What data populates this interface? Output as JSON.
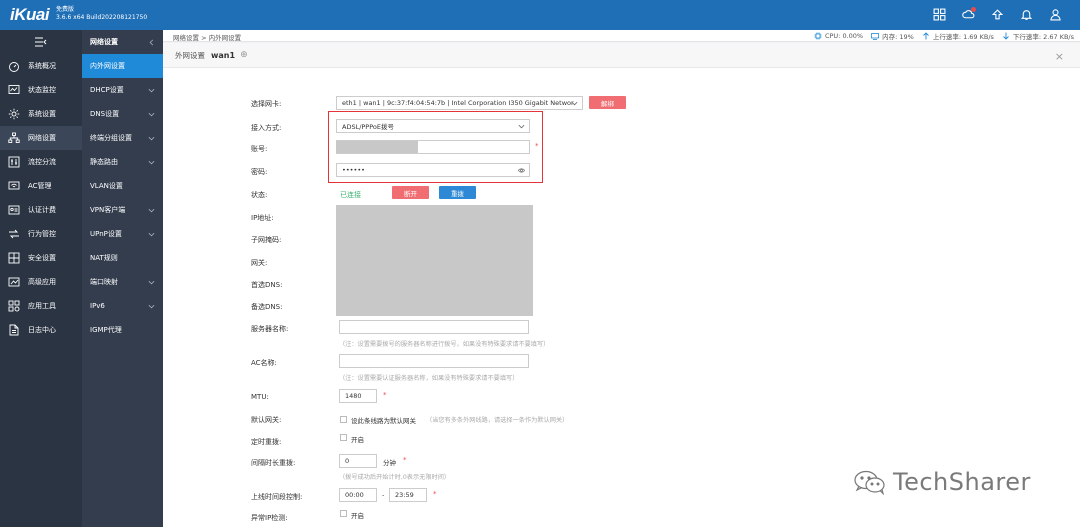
{
  "brand": {
    "logo": "iKuai",
    "edition": "免费版",
    "version": "3.6.6 x64 Build202208121750"
  },
  "topbar_icons": [
    "grid-icon",
    "cloud-icon",
    "upload-icon",
    "bell-icon",
    "user-icon"
  ],
  "sidebar": {
    "items": [
      {
        "label": "系统概况",
        "icon": "dashboard-icon"
      },
      {
        "label": "状态监控",
        "icon": "monitor-icon"
      },
      {
        "label": "系统设置",
        "icon": "gear-icon"
      },
      {
        "label": "网络设置",
        "icon": "network-icon",
        "active": true
      },
      {
        "label": "流控分流",
        "icon": "flow-icon"
      },
      {
        "label": "AC管理",
        "icon": "ac-icon"
      },
      {
        "label": "认证计费",
        "icon": "auth-icon"
      },
      {
        "label": "行为管控",
        "icon": "behavior-icon"
      },
      {
        "label": "安全设置",
        "icon": "security-icon"
      },
      {
        "label": "高级应用",
        "icon": "advanced-icon"
      },
      {
        "label": "应用工具",
        "icon": "tools-icon"
      },
      {
        "label": "日志中心",
        "icon": "log-icon"
      }
    ]
  },
  "subnav": {
    "title": "网络设置",
    "items": [
      {
        "label": "内外网设置",
        "active": true,
        "chevron": false
      },
      {
        "label": "DHCP设置",
        "chevron": true
      },
      {
        "label": "DNS设置",
        "chevron": true
      },
      {
        "label": "终端分组设置",
        "chevron": true
      },
      {
        "label": "静态路由",
        "chevron": true
      },
      {
        "label": "VLAN设置",
        "chevron": false
      },
      {
        "label": "VPN客户端",
        "chevron": true
      },
      {
        "label": "UPnP设置",
        "chevron": true
      },
      {
        "label": "NAT规则",
        "chevron": false
      },
      {
        "label": "端口映射",
        "chevron": true
      },
      {
        "label": "IPv6",
        "chevron": true
      },
      {
        "label": "IGMP代理",
        "chevron": false
      }
    ]
  },
  "breadcrumb": "网络设置 > 内外网设置",
  "stats": {
    "cpu": "CPU: 0.00%",
    "mem": "内存: 19%",
    "up": "上行速率: 1.69 KB/s",
    "down": "下行速率: 2.67 KB/s"
  },
  "panel": {
    "title": "外网设置",
    "wan": "wan1",
    "close": "×"
  },
  "form": {
    "nic_label": "选择网卡:",
    "nic_value": "eth1 | wan1 | 9c:37:f4:04:54:7b | Intel Corporation I350 Gigabit Networ",
    "unbind": "解绑",
    "access_label": "接入方式:",
    "access_value": "ADSL/PPPoE拨号",
    "account_label": "账号:",
    "password_label": "密码:",
    "password_value": "••••••",
    "status_label": "状态:",
    "status_value": "已连接",
    "disconnect": "断开",
    "redial": "重拨",
    "ip_label": "IP地址:",
    "mask_label": "子网掩码:",
    "gw_label": "网关:",
    "dns1_label": "首选DNS:",
    "dns2_label": "备选DNS:",
    "server_label": "服务器名称:",
    "server_hint": "（注：设置需要拨号的服务器名称进行拨号，如果没有特殊要求请不要填写）",
    "ac_label": "AC名称:",
    "ac_hint": "（注：设置需要认证服务器名称，如果没有特殊要求请不要填写）",
    "mtu_label": "MTU:",
    "mtu_value": "1480",
    "default_gw_label": "默认网关:",
    "default_gw_text": "设此条线路为默认网关",
    "default_gw_hint": "（当您有多条外网线路，请选择一条作为默认网关）",
    "timed_redial_label": "定时重拨:",
    "timed_redial_text": "开启",
    "interval_label": "间隔时长重拨:",
    "interval_value": "0",
    "interval_unit": "分钟",
    "interval_hint": "（拨号成功后开始计时,0表示无限时间）",
    "online_time_label": "上线时间段控制:",
    "online_from": "00:00",
    "online_sep": "-",
    "online_to": "23:59",
    "abnormal_ip_label": "异常IP检测:",
    "abnormal_ip_text": "开启"
  },
  "watermark": "TechSharer"
}
